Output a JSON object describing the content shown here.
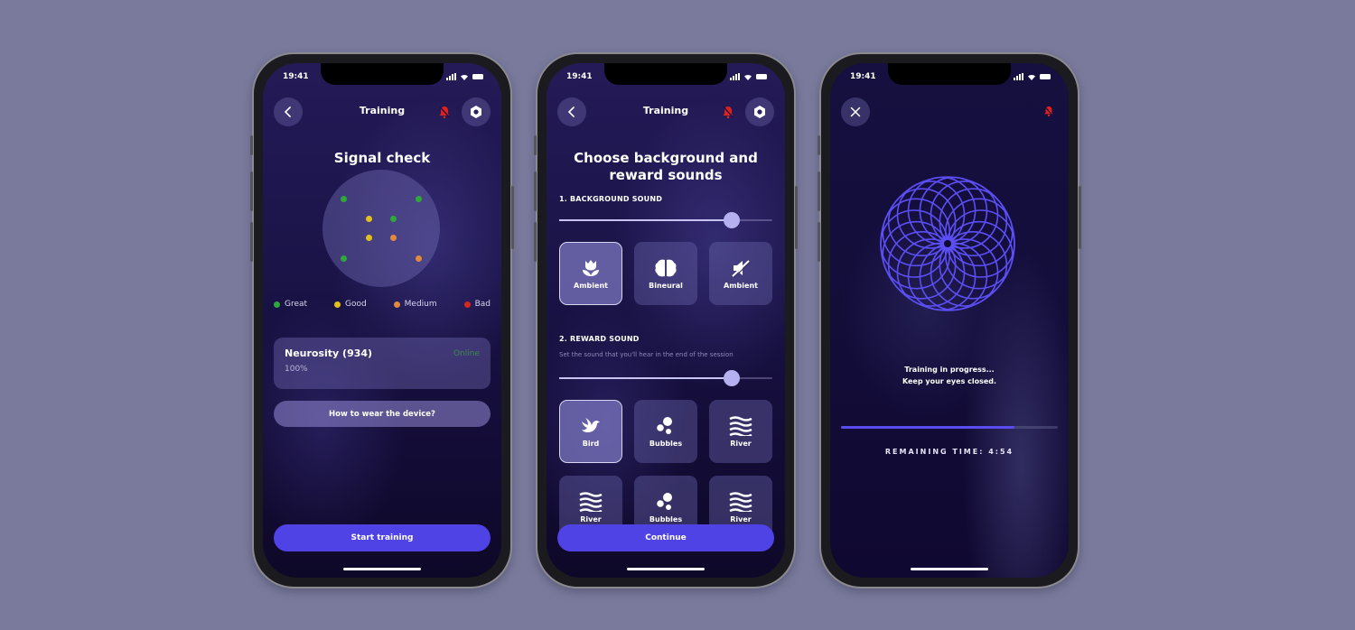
{
  "colors": {
    "page_background": "#7a7a9c",
    "accent": "#4f43e6",
    "great": "#2fa83a",
    "good": "#e2c21a",
    "medium": "#e08a3c",
    "bad": "#d8261e",
    "bell_muted": "#e0201c",
    "mandala": "#5c4ef5"
  },
  "status_bar": {
    "time": "19:41"
  },
  "screens": [
    {
      "id": "signal-check",
      "topbar": {
        "title": "Training",
        "back_icon": "chevron-left-icon",
        "bell_icon": "bell-muted-icon",
        "settings_icon": "settings-icon"
      },
      "title": "Signal check",
      "electrodes": [
        {
          "quality": "great"
        },
        {
          "quality": "great"
        },
        {
          "quality": "good"
        },
        {
          "quality": "great"
        },
        {
          "quality": "good"
        },
        {
          "quality": "medium"
        },
        {
          "quality": "great"
        },
        {
          "quality": "medium"
        }
      ],
      "legend": [
        {
          "label": "Great",
          "quality": "great"
        },
        {
          "label": "Good",
          "quality": "good"
        },
        {
          "label": "Medium",
          "quality": "medium"
        },
        {
          "label": "Bad",
          "quality": "bad"
        }
      ],
      "device": {
        "name": "Neurosity (934)",
        "status": "Online",
        "battery": "100%"
      },
      "help_button": "How to wear the device?",
      "primary_button": "Start training"
    },
    {
      "id": "sound-selection",
      "topbar": {
        "title": "Training",
        "back_icon": "chevron-left-icon",
        "bell_icon": "bell-muted-icon",
        "settings_icon": "settings-icon"
      },
      "title_line1": "Choose background and",
      "title_line2": "reward sounds",
      "background_section": {
        "label": "1. BACKGROUND SOUND",
        "volume": 0.81,
        "options": [
          {
            "label": "Ambient",
            "icon": "tulip-icon",
            "selected": true
          },
          {
            "label": "Bineural",
            "icon": "brain-icon",
            "selected": false
          },
          {
            "label": "Ambient",
            "icon": "mute-speaker-icon",
            "selected": false
          }
        ]
      },
      "reward_section": {
        "label": "2. REWARD SOUND",
        "description": "Set the sound that you'll hear in the end of the session",
        "volume": 0.81,
        "options": [
          {
            "label": "Bird",
            "icon": "bird-icon",
            "selected": true
          },
          {
            "label": "Bubbles",
            "icon": "bubbles-icon",
            "selected": false
          },
          {
            "label": "River",
            "icon": "waves-icon",
            "selected": false
          },
          {
            "label": "River",
            "icon": "waves-icon",
            "selected": false
          },
          {
            "label": "Bubbles",
            "icon": "bubbles-icon",
            "selected": false
          },
          {
            "label": "River",
            "icon": "waves-icon",
            "selected": false
          }
        ]
      },
      "primary_button": "Continue"
    },
    {
      "id": "training-progress",
      "topbar": {
        "close_icon": "close-icon",
        "bell_icon": "bell-muted-icon"
      },
      "message_line1": "Training in progress...",
      "message_line2": "Keep your eyes closed.",
      "progress": 0.8,
      "remaining_label": "REMAINING TIME: 4:54"
    }
  ]
}
